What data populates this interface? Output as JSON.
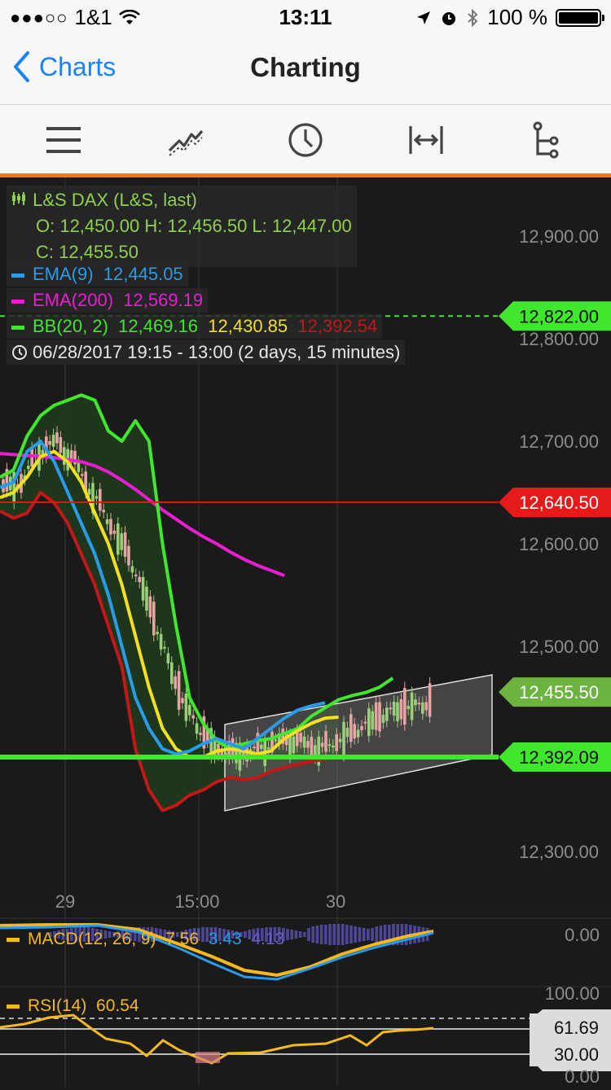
{
  "status": {
    "signal_dots": "●●●○○",
    "carrier": "1&1",
    "time": "13:11",
    "battery": "100 %",
    "battery_level": 1.0
  },
  "nav": {
    "back_label": "Charts",
    "title": "Charting"
  },
  "toolbar": {
    "items": [
      "menu-icon",
      "indicators-icon",
      "clock-icon",
      "range-icon",
      "tree-icon"
    ]
  },
  "colors": {
    "accent": "#1a82fb",
    "orange": "#e8782a",
    "green": "#41e62e",
    "blue": "#2a9be8",
    "magenta": "#e91ed2",
    "yellow": "#f3e022",
    "red": "#c31818"
  },
  "legend": {
    "instrument": "L&S DAX (L&S, last)",
    "ohlc_line1": "O: 12,450.00  H: 12,456.50  L: 12,447.00",
    "ohlc_line2": "C: 12,455.50",
    "ema9_label": "EMA(9)",
    "ema9_value": "12,445.05",
    "ema200_label": "EMA(200)",
    "ema200_value": "12,569.19",
    "bb_label": "BB(20, 2)",
    "bb_upper": "12,469.16",
    "bb_mid": "12,430.85",
    "bb_lower": "12,392.54",
    "range": "06/28/2017 19:15 - 13:00   (2 days, 15 minutes)"
  },
  "price_axis": {
    "ticks": [
      "12,900.00",
      "12,800.00",
      "12,700.00",
      "12,600.00",
      "12,500.00",
      "12,300.00"
    ],
    "tick_values": [
      12900,
      12800,
      12700,
      12600,
      12500,
      12300
    ]
  },
  "markers": {
    "m1": {
      "label": "12,822.00",
      "value": 12822
    },
    "m2": {
      "label": "12,640.50",
      "value": 12640.5
    },
    "m3": {
      "label": "12,455.50",
      "value": 12455.5
    },
    "m4": {
      "label": "12,392.09",
      "value": 12392.09
    }
  },
  "time_axis": {
    "labels": [
      "29",
      "15:00",
      "30"
    ]
  },
  "macd": {
    "label": "MACD(12, 26, 9)",
    "v1": "7.56",
    "v2": "3.43",
    "v3": "4.13",
    "zero_label": "0.00"
  },
  "rsi": {
    "label": "RSI(14)",
    "value": "60.54",
    "top_label": "100.00",
    "badge1": "61.69",
    "badge2": "30.00",
    "bottom_label": "0.00"
  },
  "chart_data": {
    "type": "line",
    "ylim": [
      12280,
      12930
    ],
    "x": [
      0,
      4,
      8,
      12,
      16,
      20,
      24,
      28,
      32,
      36,
      40,
      44,
      48,
      52,
      56,
      60,
      64,
      68,
      72,
      76,
      80,
      84,
      88,
      92,
      96,
      100,
      104,
      108,
      112,
      116,
      120,
      124,
      128
    ],
    "series": [
      {
        "name": "EMA(200)",
        "values": [
          12688,
          12687,
          12686,
          12685,
          12684,
          12682,
          12680,
          12676,
          12670,
          12662,
          12653,
          12643,
          12633,
          12624,
          12615,
          12607,
          12600,
          12592,
          12585,
          12579,
          12574,
          12569,
          null,
          null,
          null,
          null,
          null,
          null,
          null,
          null,
          null,
          null,
          null
        ]
      },
      {
        "name": "BB upper",
        "values": [
          12665,
          12672,
          12705,
          12725,
          12735,
          12740,
          12745,
          12740,
          12710,
          12700,
          12720,
          12700,
          12600,
          12520,
          12450,
          12425,
          12408,
          12400,
          12405,
          12408,
          12410,
          12415,
          12420,
          12432,
          12440,
          12448,
          12452,
          12455,
          12460,
          12469,
          null,
          null,
          null
        ]
      },
      {
        "name": "BB mid",
        "values": [
          12645,
          12650,
          12665,
          12685,
          12690,
          12680,
          12660,
          12630,
          12600,
          12560,
          12510,
          12460,
          12420,
          12400,
          12392,
          12392,
          12398,
          12400,
          12398,
          12395,
          12398,
          12410,
          12418,
          12425,
          12430,
          12431,
          null,
          null,
          null,
          null,
          null,
          null,
          null
        ]
      },
      {
        "name": "EMA(9)",
        "values": [
          12655,
          12660,
          12690,
          12700,
          12680,
          12650,
          12620,
          12590,
          12550,
          12500,
          12450,
          12420,
          12400,
          12395,
          12398,
          12405,
          12410,
          12405,
          12400,
          12410,
          12420,
          12430,
          12438,
          12442,
          12445,
          null,
          null,
          null,
          null,
          null,
          null,
          null,
          null
        ]
      },
      {
        "name": "BB lower",
        "values": [
          12632,
          12625,
          12630,
          12650,
          12640,
          12620,
          12590,
          12560,
          12520,
          12480,
          12400,
          12360,
          12340,
          12345,
          12355,
          12360,
          12368,
          12372,
          12370,
          12372,
          12378,
          12382,
          12385,
          12388,
          12390,
          12392,
          null,
          null,
          null,
          null,
          null,
          null,
          null
        ]
      }
    ]
  }
}
